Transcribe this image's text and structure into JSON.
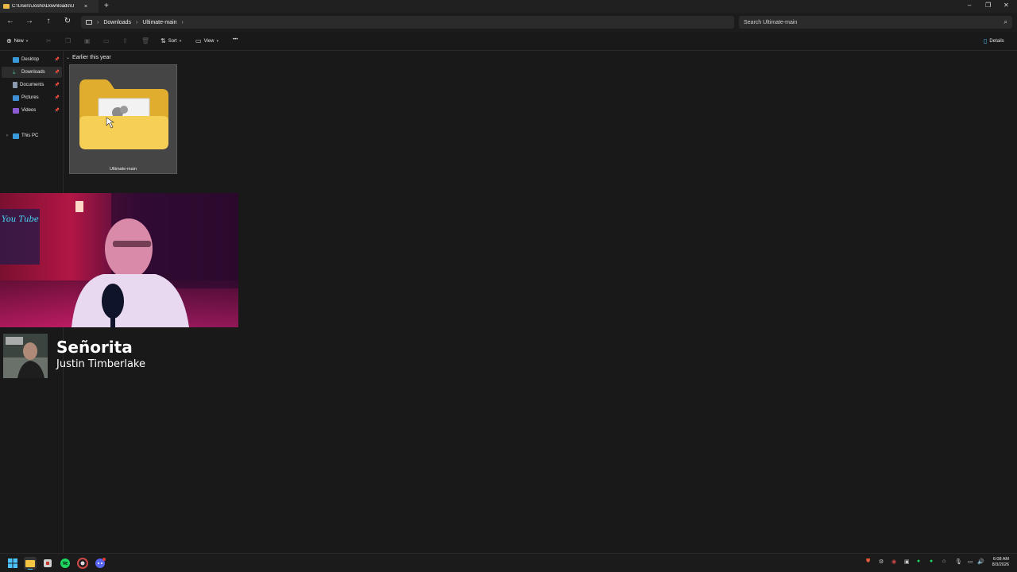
{
  "tab": {
    "title": "C:\\Users\\Josho\\Downloads\\U",
    "close": "×",
    "new_tab": "+"
  },
  "window_controls": {
    "minimize": "–",
    "maximize": "❐",
    "close": "✕"
  },
  "nav": {
    "back": "←",
    "forward": "→",
    "up": "↑",
    "refresh": "↻"
  },
  "address": {
    "segments": [
      "Downloads",
      "Ultimate-main"
    ],
    "separator": "›"
  },
  "search": {
    "placeholder": "Search Ultimate-main"
  },
  "toolbar": {
    "new_label": "New",
    "sort_label": "Sort",
    "view_label": "View",
    "more_label": "•••",
    "details_label": "Details"
  },
  "sidebar": {
    "items": [
      {
        "label": "Desktop",
        "icon": "desktop-icon",
        "color": "#3a9ad9"
      },
      {
        "label": "Downloads",
        "icon": "download-icon",
        "color": "#3fb27f"
      },
      {
        "label": "Documents",
        "icon": "document-icon",
        "color": "#8a9bb0"
      },
      {
        "label": "Pictures",
        "icon": "picture-icon",
        "color": "#3f8fd6"
      },
      {
        "label": "Videos",
        "icon": "video-icon",
        "color": "#8b5bd4"
      }
    ],
    "this_pc": "This PC"
  },
  "content": {
    "group_header": "Earlier this year",
    "items": [
      {
        "name": "Ultimate-main",
        "type": "folder"
      }
    ]
  },
  "now_playing": {
    "title": "Señorita",
    "artist": "Justin Timberlake"
  },
  "clock": {
    "time": "6:08 AM",
    "date": "8/3/2026"
  },
  "colors": {
    "accent": "#4cc2ff",
    "folder": "#f4c542",
    "spotify": "#1ed760",
    "discord": "#5865f2"
  }
}
